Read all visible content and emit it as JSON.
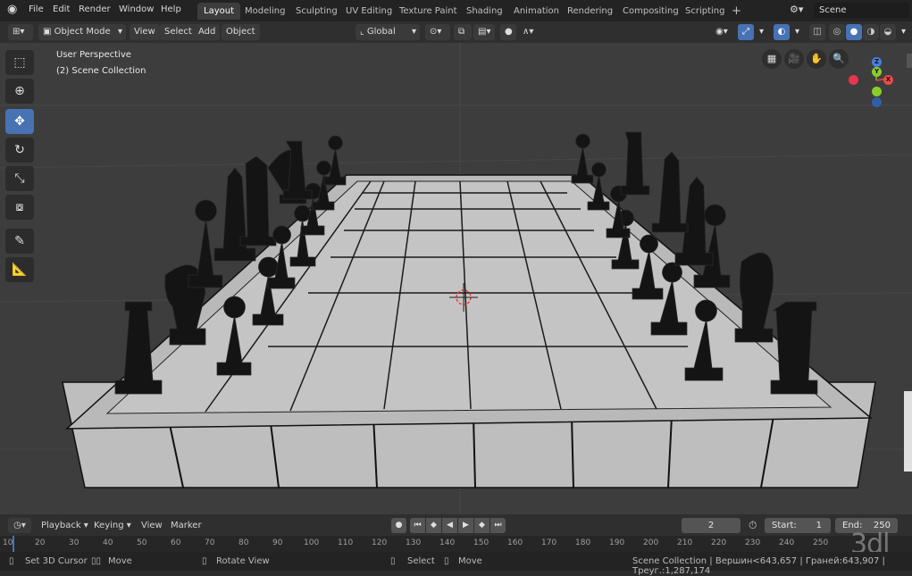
{
  "topbar": {
    "menu": [
      "File",
      "Edit",
      "Render",
      "Window",
      "Help"
    ],
    "workspaces": [
      "Layout",
      "Modeling",
      "Sculpting",
      "UV Editing",
      "Texture Paint",
      "Shading",
      "Animation",
      "Rendering",
      "Compositing",
      "Scripting"
    ],
    "active_workspace": "Layout",
    "add_tab": "+",
    "scene": "Scene"
  },
  "header": {
    "mode": "Object Mode",
    "menu": [
      "View",
      "Select",
      "Add",
      "Object"
    ],
    "orientation": "Global"
  },
  "viewport": {
    "view_name": "User Perspective",
    "collection": "(2) Scene Collection",
    "gizmo": {
      "z": "Z",
      "y": "Y",
      "x": "X"
    },
    "accent_color": "#4772b3",
    "board_color": "#c9c9c9",
    "piece_color": "#141414"
  },
  "timeline": {
    "playback": "Playback",
    "keying": "Keying",
    "view": "View",
    "marker": "Marker",
    "current_frame": "2",
    "start_label": "Start:",
    "start": "1",
    "end_label": "End:",
    "end": "250"
  },
  "ruler": [
    "10",
    "20",
    "30",
    "40",
    "50",
    "60",
    "70",
    "80",
    "90",
    "100",
    "110",
    "120",
    "130",
    "140",
    "150",
    "160",
    "170",
    "180",
    "190",
    "200",
    "210",
    "220",
    "230",
    "240",
    "250"
  ],
  "status": {
    "set_cursor": "Set 3D Cursor",
    "move1": "Move",
    "rotate": "Rotate View",
    "select": "Select",
    "move2": "Move",
    "stats": "Scene Collection | Вершин<643,657 | Граней:643,907 | Треуг.:1,287,174"
  },
  "watermark": "3dl"
}
